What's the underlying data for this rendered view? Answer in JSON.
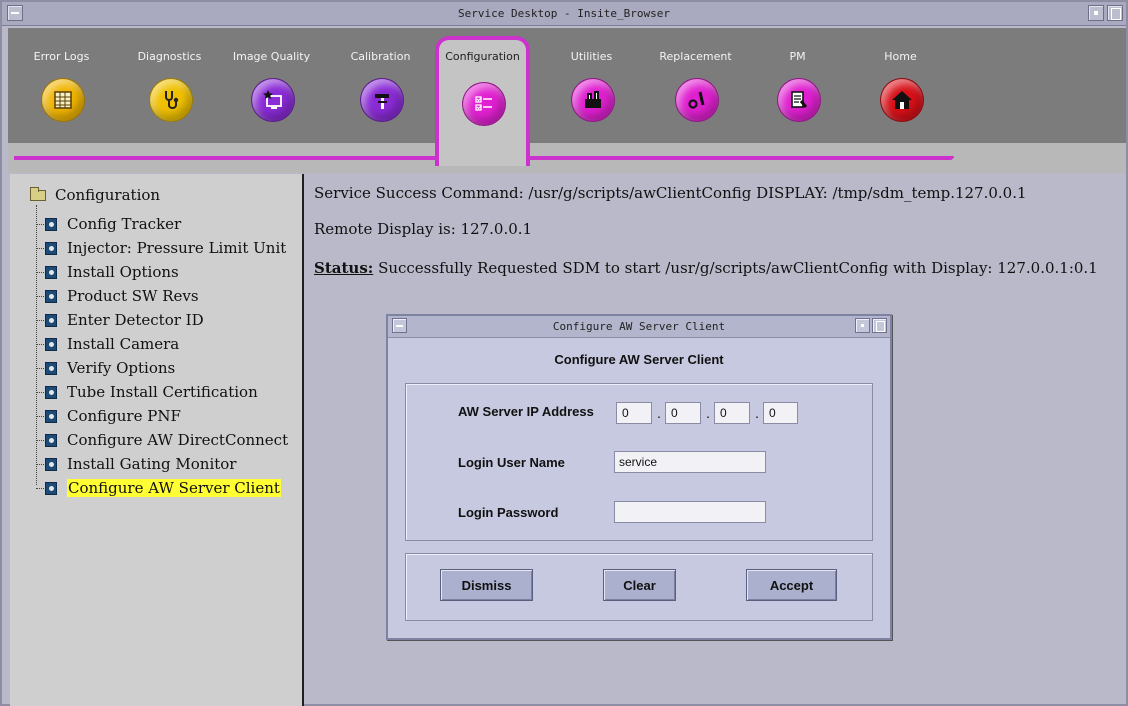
{
  "window": {
    "title": "Service Desktop - Insite_Browser"
  },
  "toolbar": {
    "tabs": [
      {
        "label": "Error Logs",
        "icon": "log-grid-icon",
        "color": "#f0b400"
      },
      {
        "label": "Diagnostics",
        "icon": "stethoscope-icon",
        "color": "#f0c000"
      },
      {
        "label": "Image Quality",
        "icon": "monitor-star-icon",
        "color": "#8a2bd6"
      },
      {
        "label": "Calibration",
        "icon": "tools-icon",
        "color": "#8a2bd6"
      },
      {
        "label": "Configuration",
        "icon": "checklist-icon",
        "color": "#e020d0",
        "active": true
      },
      {
        "label": "Utilities",
        "icon": "toolbox-icon",
        "color": "#e020d0"
      },
      {
        "label": "Replacement",
        "icon": "wrench-icon",
        "color": "#e020d0"
      },
      {
        "label": "PM",
        "icon": "clipboard-wrench-icon",
        "color": "#e020d0"
      },
      {
        "label": "Home",
        "icon": "house-icon",
        "color": "#d81018"
      }
    ]
  },
  "tree": {
    "root": "Configuration",
    "items": [
      "Config Tracker",
      "Injector: Pressure Limit Unit",
      "Install Options",
      "Product SW Revs",
      "Enter Detector ID",
      "Install Camera",
      "Verify Options",
      "Tube Install Certification",
      "Configure PNF",
      "Configure AW DirectConnect",
      "Install Gating Monitor",
      "Configure AW Server Client"
    ],
    "selected_index": 11
  },
  "main": {
    "command_line": "Service Success Command: /usr/g/scripts/awClientConfig DISPLAY: /tmp/sdm_temp.127.0.0.1",
    "remote_display": "Remote Display is: 127.0.0.1",
    "status_label": "Status:",
    "status_text": " Successfully Requested SDM to start /usr/g/scripts/awClientConfig with Display: 127.0.0.1:0.1"
  },
  "dialog": {
    "window_title": "Configure AW Server Client",
    "heading": "Configure AW Server Client",
    "ip_label": "AW Server IP Address",
    "ip_octets": [
      "0",
      "0",
      "0",
      "0"
    ],
    "ip_separator": ".",
    "user_label": "Login User Name",
    "user_value": "service",
    "password_label": "Login Password",
    "password_value": "",
    "dismiss_label": "Dismiss",
    "clear_label": "Clear",
    "accept_label": "Accept"
  }
}
